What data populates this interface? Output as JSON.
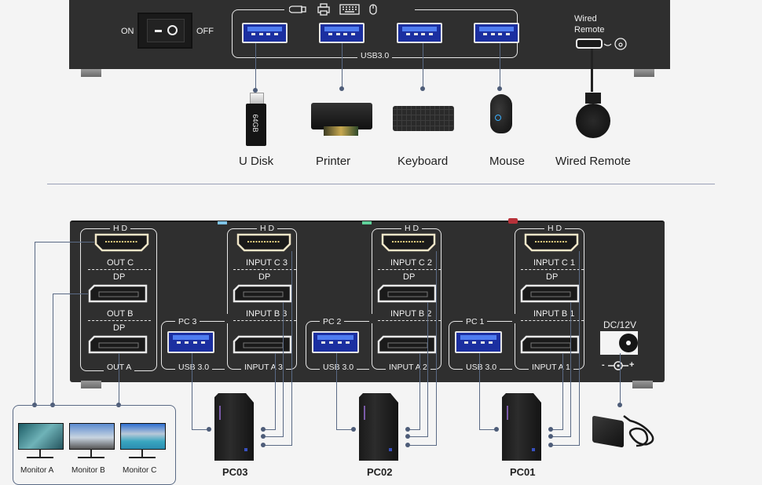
{
  "top_panel": {
    "power_switch": {
      "on_label": "ON",
      "off_label": "OFF"
    },
    "usb_hub": {
      "label": "USB3.0",
      "port_count": 4,
      "icons": [
        "usb-drive-icon",
        "printer-icon",
        "keyboard-icon",
        "mouse-icon"
      ]
    },
    "wired_remote": {
      "label_line1": "Wired",
      "label_line2": "Remote"
    }
  },
  "peripherals": [
    {
      "name": "U Disk",
      "badge": "64GB"
    },
    {
      "name": "Printer"
    },
    {
      "name": "Keyboard"
    },
    {
      "name": "Mouse"
    },
    {
      "name": "Wired Remote"
    }
  ],
  "bottom_panel": {
    "outputs": {
      "hd_label": "H D",
      "dp_label": "DP",
      "ports": [
        "OUT C",
        "OUT B",
        "OUT A"
      ]
    },
    "pc_groups": [
      {
        "pc_label": "PC 3",
        "usb_label": "USB 3.0",
        "hd_label": "H D",
        "dp_label": "DP",
        "inputs": [
          "INPUT C 3",
          "INPUT B 3",
          "INPUT A 3"
        ],
        "led_color": "#7ec3e6"
      },
      {
        "pc_label": "PC 2",
        "usb_label": "USB 3.0",
        "hd_label": "H D",
        "dp_label": "DP",
        "inputs": [
          "INPUT C 2",
          "INPUT B 2",
          "INPUT A 2"
        ],
        "led_color": "#5fd19a"
      },
      {
        "pc_label": "PC 1",
        "usb_label": "USB 3.0",
        "hd_label": "H D",
        "dp_label": "DP",
        "inputs": [
          "INPUT C 1",
          "INPUT B 1",
          "INPUT A 1"
        ],
        "led_color": "#b8323a"
      }
    ],
    "power": {
      "label": "DC/12V",
      "polarity_minus": "-",
      "polarity_plus": "+"
    }
  },
  "monitors": [
    "Monitor A",
    "Monitor B",
    "Monitor C"
  ],
  "computers": [
    "PC03",
    "PC02",
    "PC01"
  ]
}
